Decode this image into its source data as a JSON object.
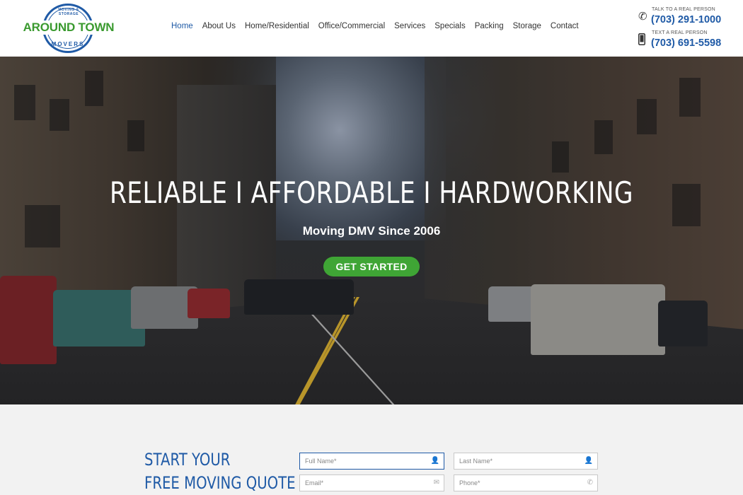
{
  "header": {
    "logo": {
      "top_text": "MOVING & STORAGE",
      "main_text": "AROUND TOWN",
      "bottom_text": "MOVERS"
    },
    "nav": [
      {
        "label": "Home",
        "active": true
      },
      {
        "label": "About Us"
      },
      {
        "label": "Home/Residential"
      },
      {
        "label": "Office/Commercial"
      },
      {
        "label": "Services"
      },
      {
        "label": "Specials"
      },
      {
        "label": "Packing"
      },
      {
        "label": "Storage"
      },
      {
        "label": "Contact"
      }
    ],
    "phones": [
      {
        "caption": "TALK TO A REAL PERSON",
        "number": "(703) 291-1000",
        "icon": "phone-icon"
      },
      {
        "caption": "TEXT A REAL PERSON",
        "number": "(703) 691-5598",
        "icon": "mobile-icon"
      }
    ]
  },
  "hero": {
    "title": "RELIABLE  I  AFFORDABLE  I  HARDWORKING",
    "subtitle": "Moving DMV Since 2006",
    "cta_label": "GET STARTED"
  },
  "quote": {
    "title_line1": "START YOUR",
    "title_line2": "FREE MOVING QUOTE",
    "fields": {
      "full_name": {
        "placeholder": "Full Name*",
        "icon": "user-icon"
      },
      "last_name": {
        "placeholder": "Last Name*",
        "icon": "user-icon"
      },
      "email": {
        "placeholder": "Email*",
        "icon": "email-icon"
      },
      "phone": {
        "placeholder": "Phone*",
        "icon": "phone-icon"
      }
    }
  },
  "colors": {
    "brand_blue": "#1f5aa6",
    "brand_green": "#3fa535"
  }
}
